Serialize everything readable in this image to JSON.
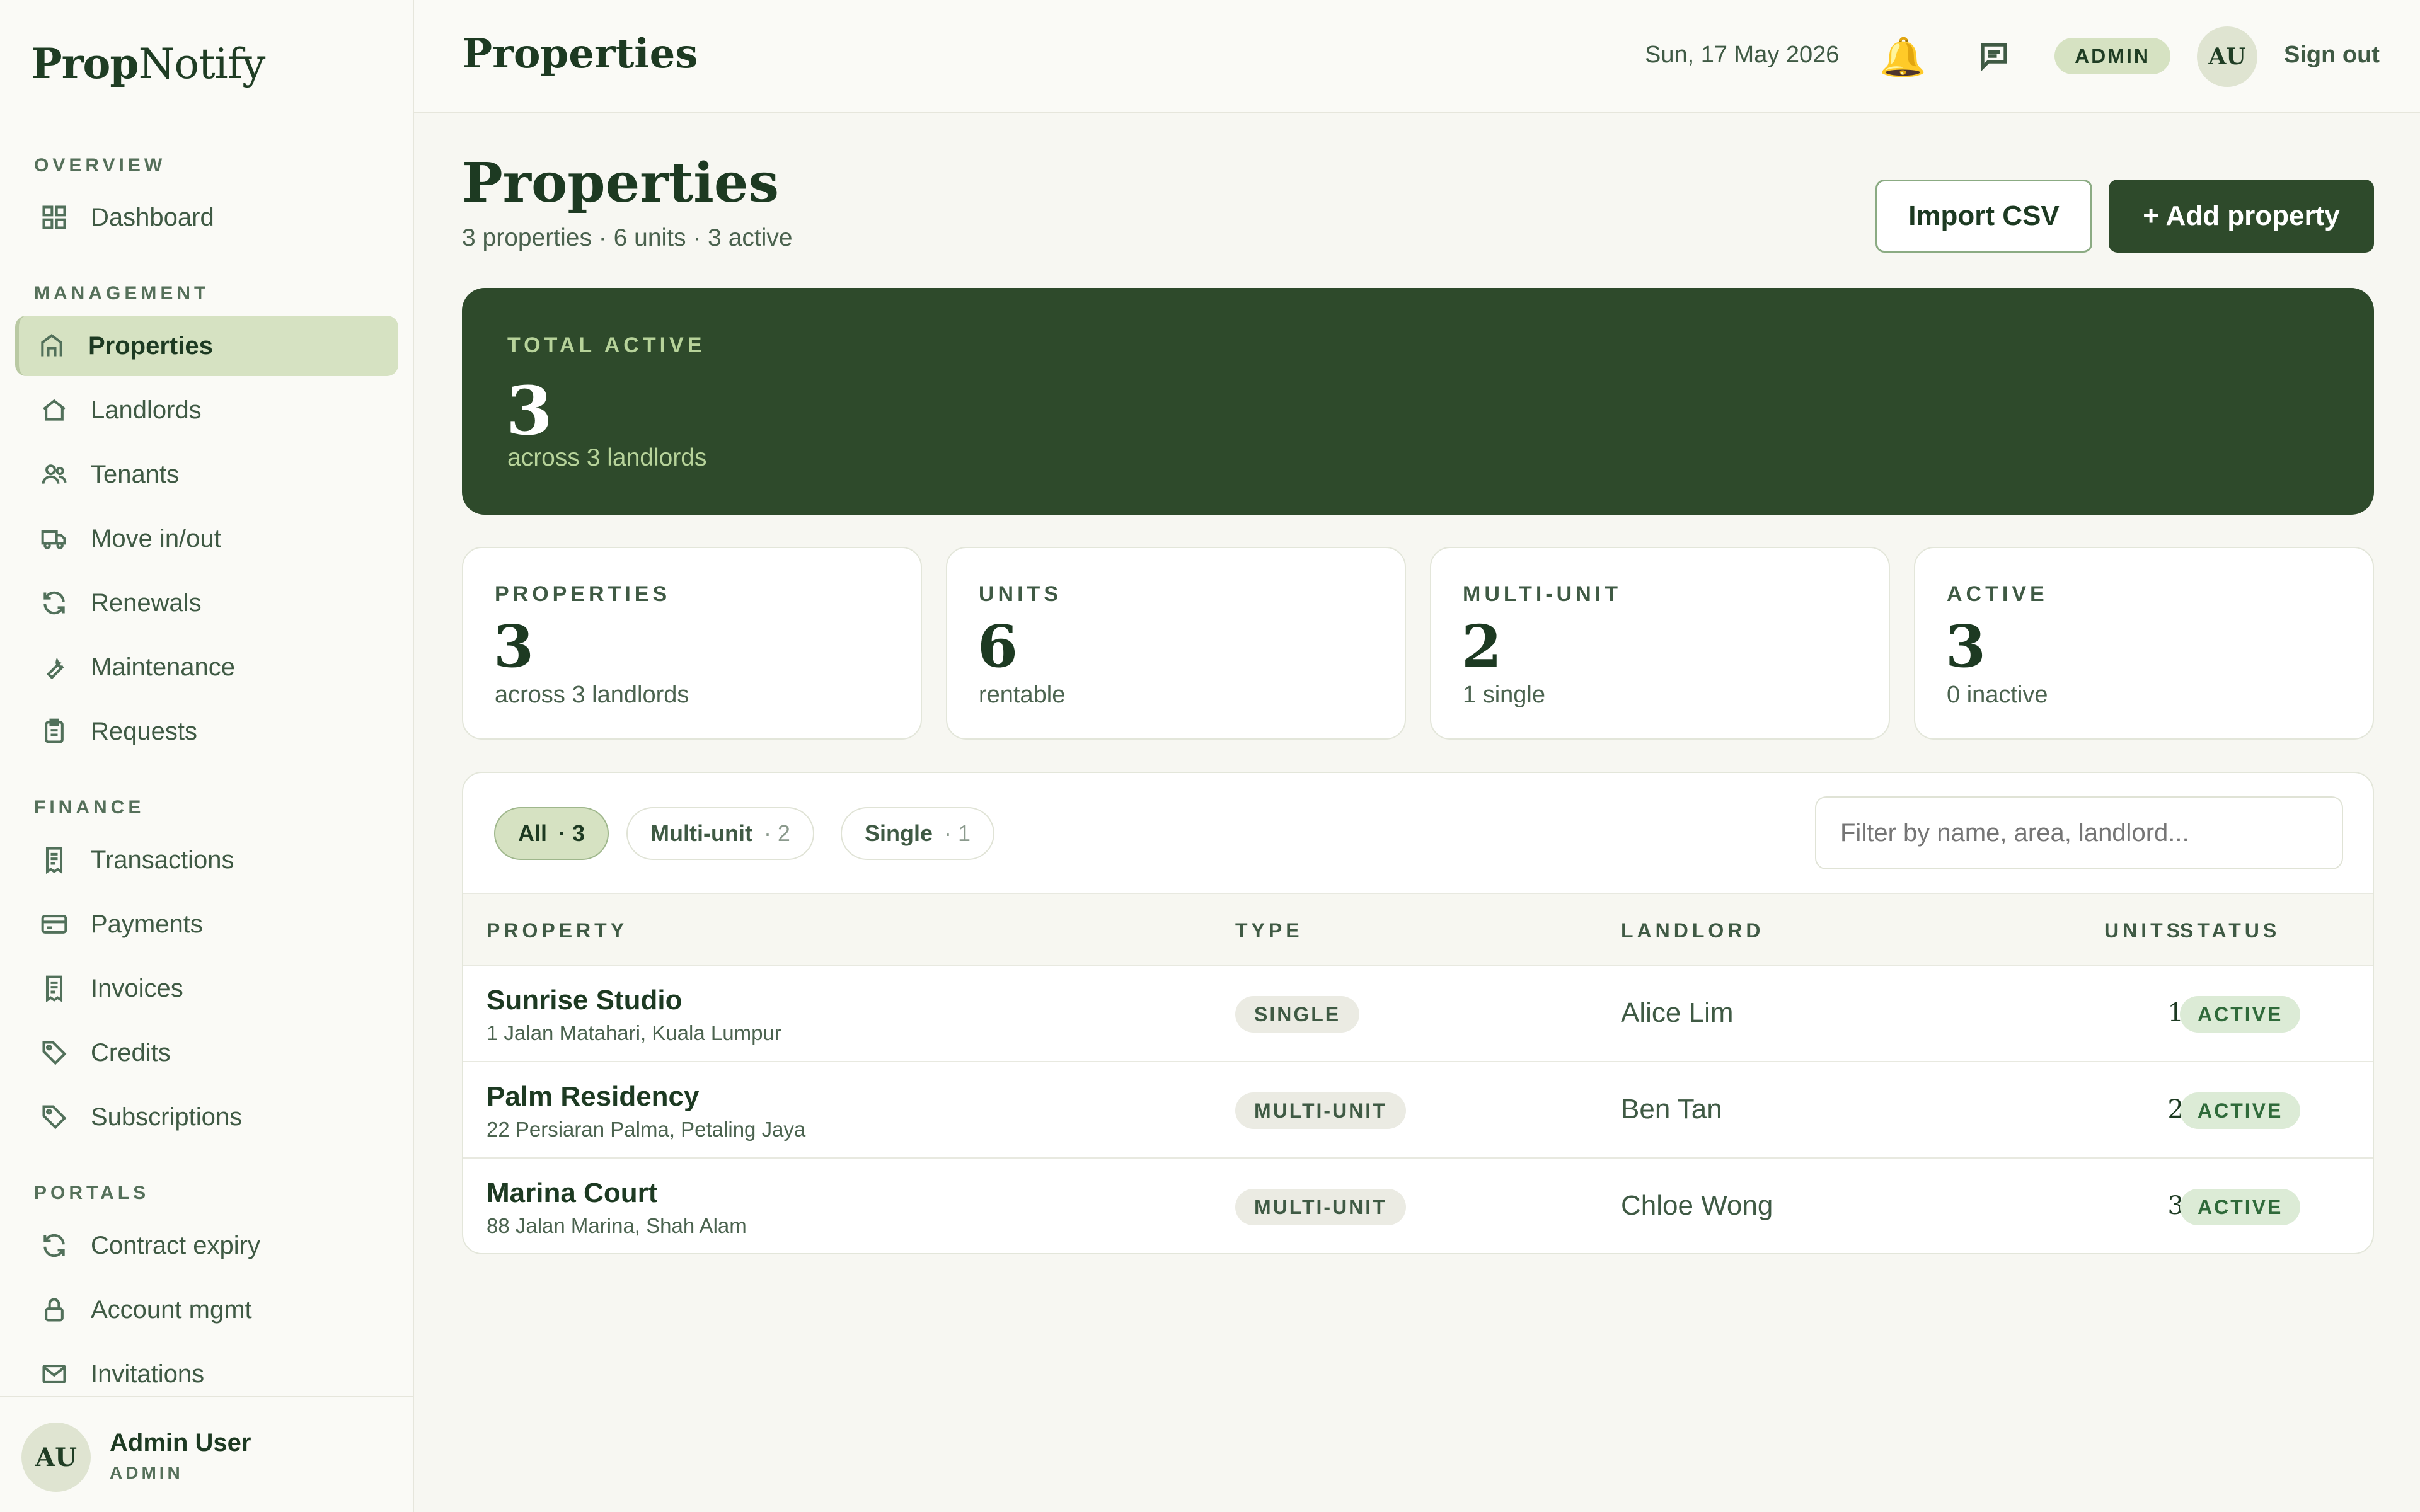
{
  "brand": {
    "bold": "Prop",
    "light": "Notify"
  },
  "sidebar": {
    "sections": [
      {
        "label": "OVERVIEW",
        "items": [
          {
            "label": "Dashboard",
            "icon": "grid-icon"
          }
        ]
      },
      {
        "label": "MANAGEMENT",
        "items": [
          {
            "label": "Properties",
            "icon": "building-icon",
            "active": true
          },
          {
            "label": "Landlords",
            "icon": "home-icon"
          },
          {
            "label": "Tenants",
            "icon": "users-icon"
          },
          {
            "label": "Move in/out",
            "icon": "truck-icon"
          },
          {
            "label": "Renewals",
            "icon": "refresh-icon"
          },
          {
            "label": "Maintenance",
            "icon": "wrench-icon"
          },
          {
            "label": "Requests",
            "icon": "clipboard-icon"
          }
        ]
      },
      {
        "label": "FINANCE",
        "items": [
          {
            "label": "Transactions",
            "icon": "receipt-icon"
          },
          {
            "label": "Payments",
            "icon": "card-icon"
          },
          {
            "label": "Invoices",
            "icon": "receipt-icon"
          },
          {
            "label": "Credits",
            "icon": "tag-icon"
          },
          {
            "label": "Subscriptions",
            "icon": "tag-icon"
          }
        ]
      },
      {
        "label": "PORTALS",
        "items": [
          {
            "label": "Contract expiry",
            "icon": "refresh-icon"
          },
          {
            "label": "Account mgmt",
            "icon": "lock-icon"
          },
          {
            "label": "Invitations",
            "icon": "mail-icon"
          }
        ]
      }
    ],
    "user": {
      "initials": "AU",
      "name": "Admin User",
      "role": "ADMIN"
    }
  },
  "topbar": {
    "title": "Properties",
    "date": "Sun, 17 May 2026",
    "role_badge": "ADMIN",
    "avatar_initials": "AU",
    "sign_out": "Sign out"
  },
  "page": {
    "title": "Properties",
    "subtitle": "3 properties · 6 units · 3 active",
    "import_label": "Import CSV",
    "add_label": "+ Add property"
  },
  "hero": {
    "label": "TOTAL ACTIVE",
    "value": "3",
    "sub": "across 3 landlords"
  },
  "stats": [
    {
      "label": "PROPERTIES",
      "value": "3",
      "sub": "across 3 landlords"
    },
    {
      "label": "UNITS",
      "value": "6",
      "sub": "rentable"
    },
    {
      "label": "MULTI-UNIT",
      "value": "2",
      "sub": "1 single"
    },
    {
      "label": "ACTIVE",
      "value": "3",
      "sub": "0 inactive"
    }
  ],
  "filters": {
    "chips": [
      {
        "label": "All",
        "count": "· 3",
        "active": true
      },
      {
        "label": "Multi-unit",
        "count": "· 2"
      },
      {
        "label": "Single",
        "count": "· 1"
      }
    ],
    "search_placeholder": "Filter by name, area, landlord..."
  },
  "table": {
    "columns": {
      "property": "PROPERTY",
      "type": "TYPE",
      "landlord": "LANDLORD",
      "units": "UNITS",
      "status": "STATUS"
    },
    "rows": [
      {
        "name": "Sunrise Studio",
        "address": "1 Jalan Matahari, Kuala Lumpur",
        "type": "SINGLE",
        "landlord": "Alice Lim",
        "units": "1",
        "status": "ACTIVE"
      },
      {
        "name": "Palm Residency",
        "address": "22 Persiaran Palma, Petaling Jaya",
        "type": "MULTI-UNIT",
        "landlord": "Ben Tan",
        "units": "2",
        "status": "ACTIVE"
      },
      {
        "name": "Marina Court",
        "address": "88 Jalan Marina, Shah Alam",
        "type": "MULTI-UNIT",
        "landlord": "Chloe Wong",
        "units": "3",
        "status": "ACTIVE"
      }
    ]
  },
  "colors": {
    "brand_green": "#2e4a2b",
    "active_nav": "#d6e2c2",
    "accent_light": "#b7d39a"
  }
}
